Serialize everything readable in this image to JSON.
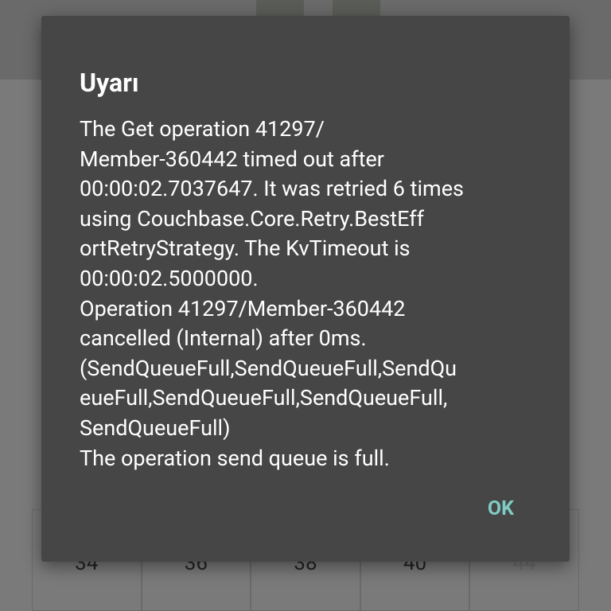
{
  "dialog": {
    "title": "Uyarı",
    "message": "The Get operation 41297/\nMember-360442 timed out after\n00:00:02.7037647. It was retried 6 times\nusing Couchbase.Core.Retry.BestEff\nortRetryStrategy. The KvTimeout is\n00:00:02.5000000.\nOperation 41297/Member-360442\ncancelled (Internal) after 0ms.\n(SendQueueFull,SendQueueFull,SendQu\neueFull,SendQueueFull,SendQueueFull,\nSendQueueFull)\nThe operation send queue is full.",
    "ok_label": "OK"
  },
  "background": {
    "size_options": [
      "34",
      "36",
      "38",
      "40",
      "44"
    ]
  },
  "colors": {
    "dialog_bg": "#464646",
    "accent": "#80cbc4",
    "scrim": "#6b6b6b"
  }
}
